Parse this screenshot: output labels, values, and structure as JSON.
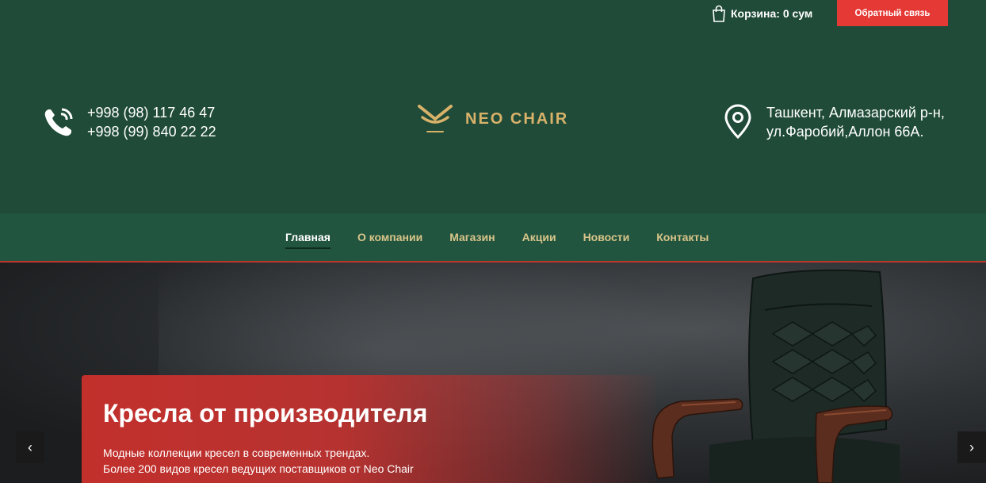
{
  "topbar": {
    "cart_label": "Корзина: 0 сум",
    "callback_label": "Обратный связь"
  },
  "header": {
    "phones": [
      "+998 (98) 117 46 47",
      "+998 (99) 840 22 22"
    ],
    "logo_text": "NEO CHAIR",
    "address": [
      "Ташкент, Алмазарский р-н,",
      "ул.Фаробий,Аллон 66А."
    ]
  },
  "nav": {
    "items": [
      {
        "label": "Главная",
        "active": true
      },
      {
        "label": "О компании"
      },
      {
        "label": "Магазин"
      },
      {
        "label": "Акции"
      },
      {
        "label": "Новости"
      },
      {
        "label": "Контакты"
      }
    ]
  },
  "hero": {
    "title": "Кресла от производителя",
    "lines": [
      "Модные коллекции кресел в современных трендах.",
      "Более 200 видов кресел ведущих поставщиков от Neo Chair"
    ],
    "prev_icon": "chevron-left-icon",
    "next_icon": "chevron-right-icon"
  },
  "colors": {
    "header_bg": "#1f4b38",
    "nav_bg": "#22553f",
    "accent_red": "#e53935",
    "logo_gold": "#d9b26a"
  }
}
